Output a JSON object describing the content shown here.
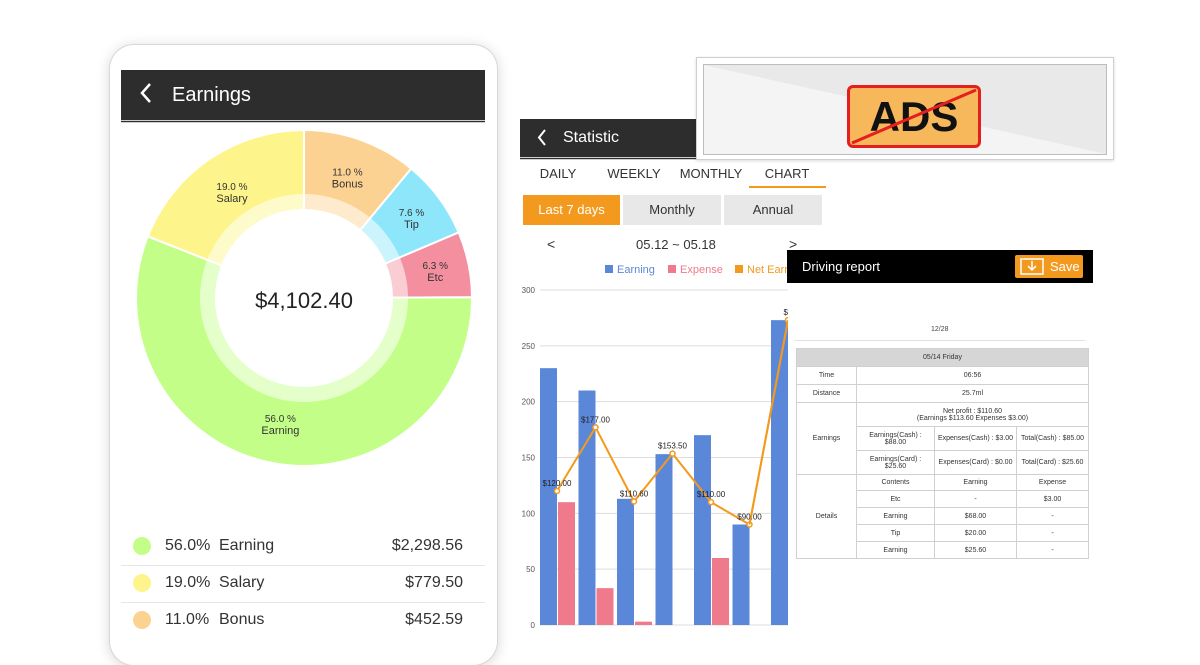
{
  "colors": {
    "earning": "#c3ff88",
    "salary": "#fdf58c",
    "bonus": "#fcd293",
    "tip": "#8ee6fb",
    "etc": "#f48fa0",
    "bar_earning": "#5b87d9",
    "bar_expense": "#ef7a8b",
    "net_line": "#f39a1e",
    "header_dark": "#2d2d2d",
    "accent": "#f39a1e"
  },
  "earnings": {
    "title": "Earnings",
    "back_icon": "chevron-left-icon",
    "total": "$4,102.40",
    "donut": [
      {
        "pct": "56.0 %",
        "name": "Earning",
        "value": 56.0
      },
      {
        "pct": "19.0 %",
        "name": "Salary",
        "value": 19.0
      },
      {
        "pct": "11.0 %",
        "name": "Bonus",
        "value": 11.0
      },
      {
        "pct": "7.6 %",
        "name": "Tip",
        "value": 7.6
      },
      {
        "pct": "6.3 %",
        "name": "Etc",
        "value": 6.3
      }
    ],
    "legend": [
      {
        "pct": "56.0%",
        "name": "Earning",
        "amount": "$2,298.56"
      },
      {
        "pct": "19.0%",
        "name": "Salary",
        "amount": "$779.50"
      },
      {
        "pct": "11.0%",
        "name": "Bonus",
        "amount": "$452.59"
      }
    ]
  },
  "statistic": {
    "title": "Statistic",
    "back_icon": "chevron-left-icon",
    "tabs": [
      "DAILY",
      "WEEKLY",
      "MONTHLY",
      "CHART"
    ],
    "active_tab": "CHART",
    "ranges": [
      "Last 7 days",
      "Monthly",
      "Annual"
    ],
    "active_range": "Last 7 days",
    "prev": "<",
    "next": ">",
    "date_range": "05.12 ~ 05.18",
    "legend": [
      "Earning",
      "Expense",
      "Net Earn"
    ]
  },
  "chart_data": {
    "type": "bar",
    "ylim": [
      0,
      300
    ],
    "yticks": [
      "0",
      "50",
      "100",
      "150",
      "200",
      "250",
      "300"
    ],
    "series": [
      {
        "name": "Earning",
        "values": [
          230,
          210,
          113,
          153,
          170,
          90,
          273
        ]
      },
      {
        "name": "Expense",
        "values": [
          110,
          33,
          3,
          0,
          60,
          0,
          0
        ]
      },
      {
        "name": "Net Earn",
        "values": [
          120,
          177,
          110.6,
          153.5,
          110,
          90,
          273
        ]
      }
    ],
    "data_labels": [
      "$120.00",
      "$177.00",
      "$110.60",
      "$153.50",
      "$110.00",
      "$90.00",
      "$2"
    ]
  },
  "ads": {
    "label": "ADS"
  },
  "driving_report": {
    "title": "Driving report",
    "save_label": "Save",
    "save_icon": "download-icon",
    "date": "12/28",
    "day": "05/14 Friday",
    "time_label": "Time",
    "time": "06:56",
    "distance_label": "Distance",
    "distance": "25.7ml",
    "earnings_label": "Earnings",
    "net_profit": "Net profit : $110.60",
    "net_detail": "(Earnings $113.60 Expenses $3.00)",
    "cash_row": [
      "Earnings(Cash) : $88.00",
      "Expenses(Cash) : $3.00",
      "Total(Cash) : $85.00"
    ],
    "card_row": [
      "Earnings(Card) : $25.60",
      "Expenses(Card) : $0.00",
      "Total(Card) : $25.60"
    ],
    "details_label": "Details",
    "details_headers": [
      "Contents",
      "Earning",
      "Expense"
    ],
    "details_rows": [
      [
        "Etc",
        "-",
        "$3.00"
      ],
      [
        "Earning",
        "$68.00",
        "-"
      ],
      [
        "Tip",
        "$20.00",
        "-"
      ],
      [
        "Earning",
        "$25.60",
        "-"
      ]
    ]
  }
}
